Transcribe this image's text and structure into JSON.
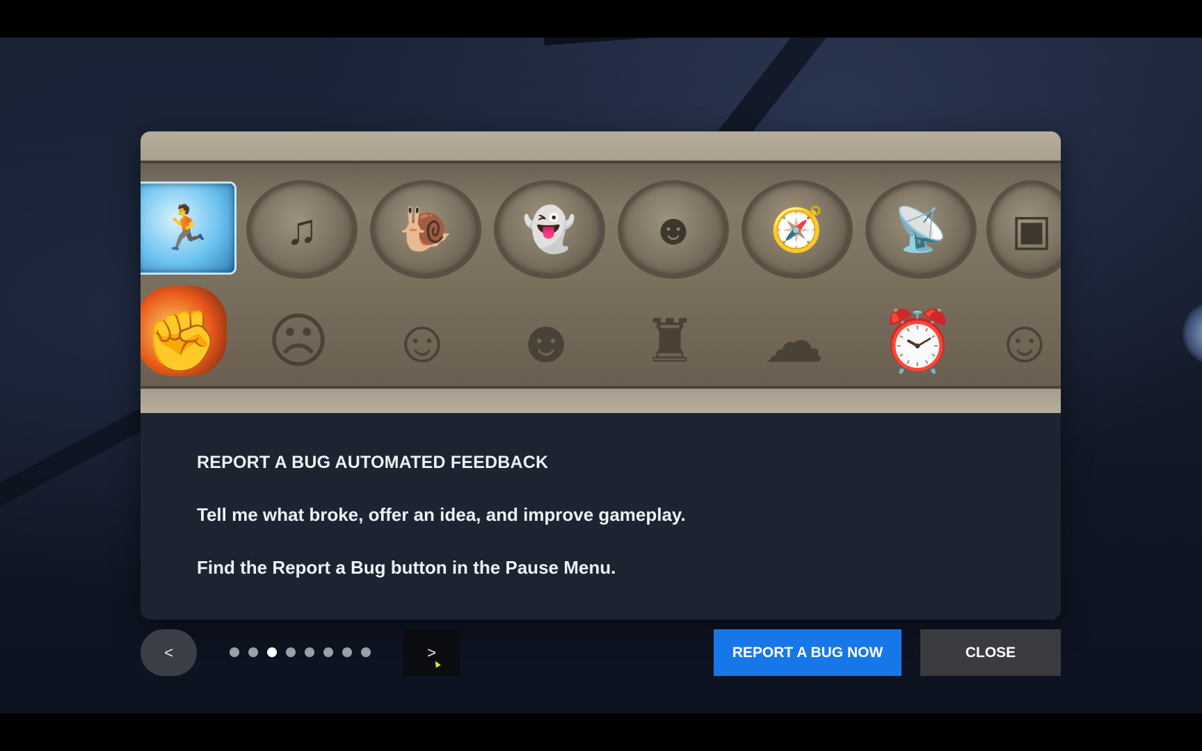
{
  "dialog": {
    "heading": "REPORT A BUG AUTOMATED FEEDBACK",
    "line1": "Tell me what broke, offer an idea, and improve gameplay.",
    "line2": "Find the Report a Bug button in the Pause Menu."
  },
  "hero_icons": {
    "top_row": [
      "frozen-runner-icon",
      "gramophone-icon",
      "snail-and-car-icon",
      "soldier-with-ghosts-icon",
      "broken-wall-figure-icon",
      "map-and-compass-icon",
      "satellite-dish-icon",
      "treasure-chest-icon"
    ],
    "bottom_row": [
      "burning-fist-icon",
      "frustrated-person-icon",
      "confused-face-icon",
      "jester-icon",
      "crumbling-statue-icon",
      "sad-person-rain-cloud-icon",
      "clock-gears-icon",
      "mask-face-icon"
    ]
  },
  "navigation": {
    "prev_label": "<",
    "next_label": ">",
    "page_count": 8,
    "current_page": 3
  },
  "buttons": {
    "report_label": "REPORT A BUG NOW",
    "close_label": "CLOSE"
  },
  "colors": {
    "accent": "#1877e8",
    "panel": "#1c2331",
    "close": "#3b3c40"
  }
}
